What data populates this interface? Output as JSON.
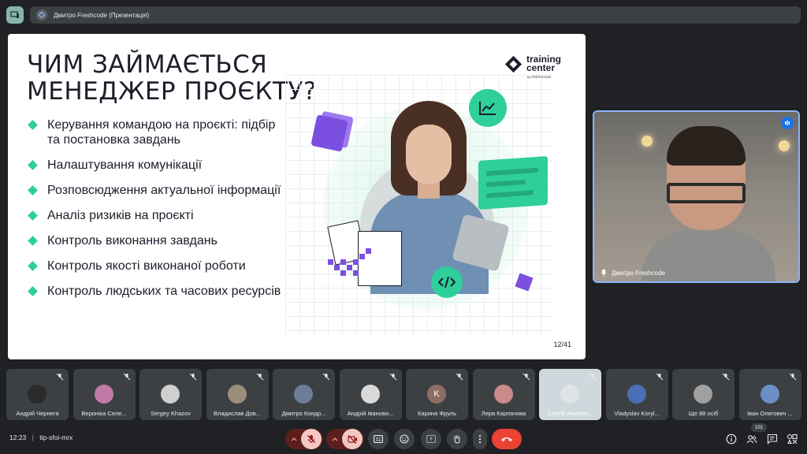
{
  "presentation_bar": {
    "label": "Дмитро Freshcode (Презентація)"
  },
  "slide": {
    "title": "ЧИМ ЗАЙМАЄТЬСЯ МЕНЕДЖЕР ПРОЄКТУ?",
    "bullets": [
      "Керування командою на проєкті: підбір та постановка завдань",
      "Налаштування комунікації",
      "Розповсюдження актуальної інформації",
      "Аналіз ризиків на проєкті",
      "Контроль виконання завдань",
      "Контроль якості виконаної роботи",
      "Контроль людських та часових ресурсів"
    ],
    "logo_line1": "training",
    "logo_line2": "center",
    "logo_by": "by FRESHCODE",
    "page": "12/41",
    "accent": "#2ecf9a",
    "purple": "#7b4fe0"
  },
  "speaker": {
    "name": "Дмитро Freshcode"
  },
  "participants": [
    {
      "name": "Андрій Чернега",
      "initial": ""
    },
    {
      "name": "Вероніка Селе...",
      "initial": ""
    },
    {
      "name": "Sergey Khazov",
      "initial": ""
    },
    {
      "name": "Владислав Дов...",
      "initial": ""
    },
    {
      "name": "Дмитро Кондр...",
      "initial": ""
    },
    {
      "name": "Андрій Іванови...",
      "initial": ""
    },
    {
      "name": "Карина Фруль",
      "initial": "K"
    },
    {
      "name": "Лера Карпачова",
      "initial": ""
    },
    {
      "name": "Сергій Анатолі...",
      "initial": ""
    },
    {
      "name": "Vladyslav Koryl...",
      "initial": ""
    },
    {
      "name": "Ще 88 осіб",
      "initial": ""
    },
    {
      "name": "Іван Олегович ...",
      "initial": ""
    }
  ],
  "bottom": {
    "time": "12:23",
    "separator": "|",
    "meeting_code": "tip-sfoi-mrx",
    "people_count": "101"
  },
  "colors": {
    "end_call": "#ea4335",
    "muted_bg": "#5b1f1c",
    "muted_fill": "#f4c7c3",
    "speaking_border": "#8ab4f8"
  }
}
